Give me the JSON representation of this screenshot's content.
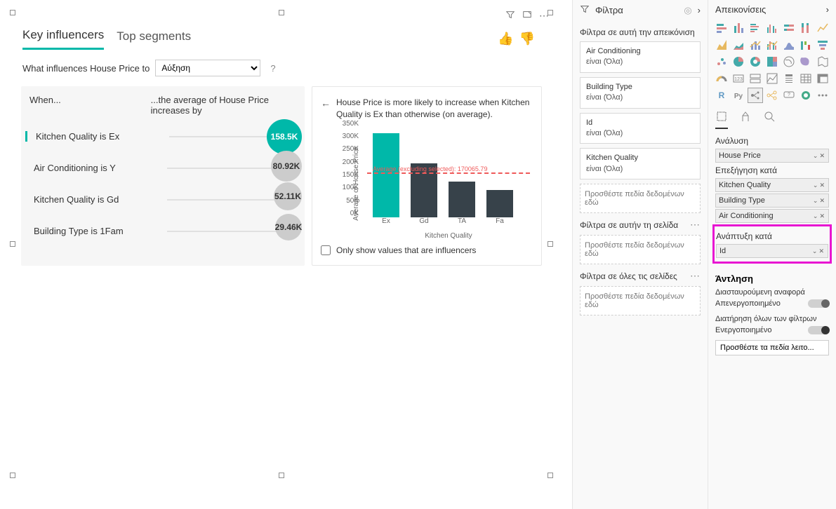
{
  "tabs": {
    "ki": "Key influencers",
    "ts": "Top segments"
  },
  "question": {
    "prefix": "What influences House Price to",
    "select": "Αύξηση"
  },
  "left_head": {
    "when": "When...",
    "then": "...the average of House Price increases by"
  },
  "influencers": [
    {
      "label": "Kitchen Quality is Ex",
      "value": "158.5K"
    },
    {
      "label": "Air Conditioning is Y",
      "value": "80.92K"
    },
    {
      "label": "Kitchen Quality is Gd",
      "value": "52.11K"
    },
    {
      "label": "Building Type is 1Fam",
      "value": "29.46K"
    }
  ],
  "explain": "House Price is more likely to increase when Kitchen Quality is Ex than otherwise (on average).",
  "avg_label": "Average (excluding selected): 170065.79",
  "only_inf": "Only show values that are influencers",
  "chart_data": {
    "type": "bar",
    "title": "",
    "xlabel": "Kitchen Quality",
    "ylabel": "Average of House Price",
    "categories": [
      "Ex",
      "Gd",
      "TA",
      "Fa"
    ],
    "values": [
      328000,
      210000,
      140000,
      105000
    ],
    "ylim": [
      0,
      350000
    ],
    "yticks": [
      "0K",
      "50K",
      "100K",
      "150K",
      "200K",
      "250K",
      "300K",
      "350K"
    ],
    "avg_excluding_selected": 170065.79,
    "selected_index": 0
  },
  "filters": {
    "title": "Φίλτρα",
    "visual_head": "Φίλτρα σε αυτή την απεικόνιση",
    "page_head": "Φίλτρα σε αυτήν τη σελίδα",
    "all_head": "Φίλτρα σε όλες τις σελίδες",
    "add_fields": "Προσθέστε πεδία δεδομένων εδώ",
    "visual": [
      {
        "name": "Air Conditioning",
        "state": "είναι (Όλα)"
      },
      {
        "name": "Building Type",
        "state": "είναι (Όλα)"
      },
      {
        "name": "Id",
        "state": "είναι (Όλα)"
      },
      {
        "name": "Kitchen Quality",
        "state": "είναι (Όλα)"
      }
    ]
  },
  "viz": {
    "title": "Απεικονίσεις",
    "modes": {
      "analysis": "Ανάλυση",
      "explain": "Επεξήγηση κατά",
      "expand": "Ανάπτυξη κατά"
    },
    "analyze_field": "House Price",
    "explain_fields": [
      "Kitchen Quality",
      "Building Type",
      "Air Conditioning"
    ],
    "expand_field": "Id",
    "drill_title": "Άντληση",
    "cross": {
      "label": "Διασταυρούμενη αναφορά",
      "state": "Απενεργοποιημένο"
    },
    "keep": {
      "label": "Διατήρηση όλων των φίλτρων",
      "state": "Ενεργοποιημένο"
    },
    "drill_btn": "Προσθέστε τα πεδία λειτο..."
  }
}
